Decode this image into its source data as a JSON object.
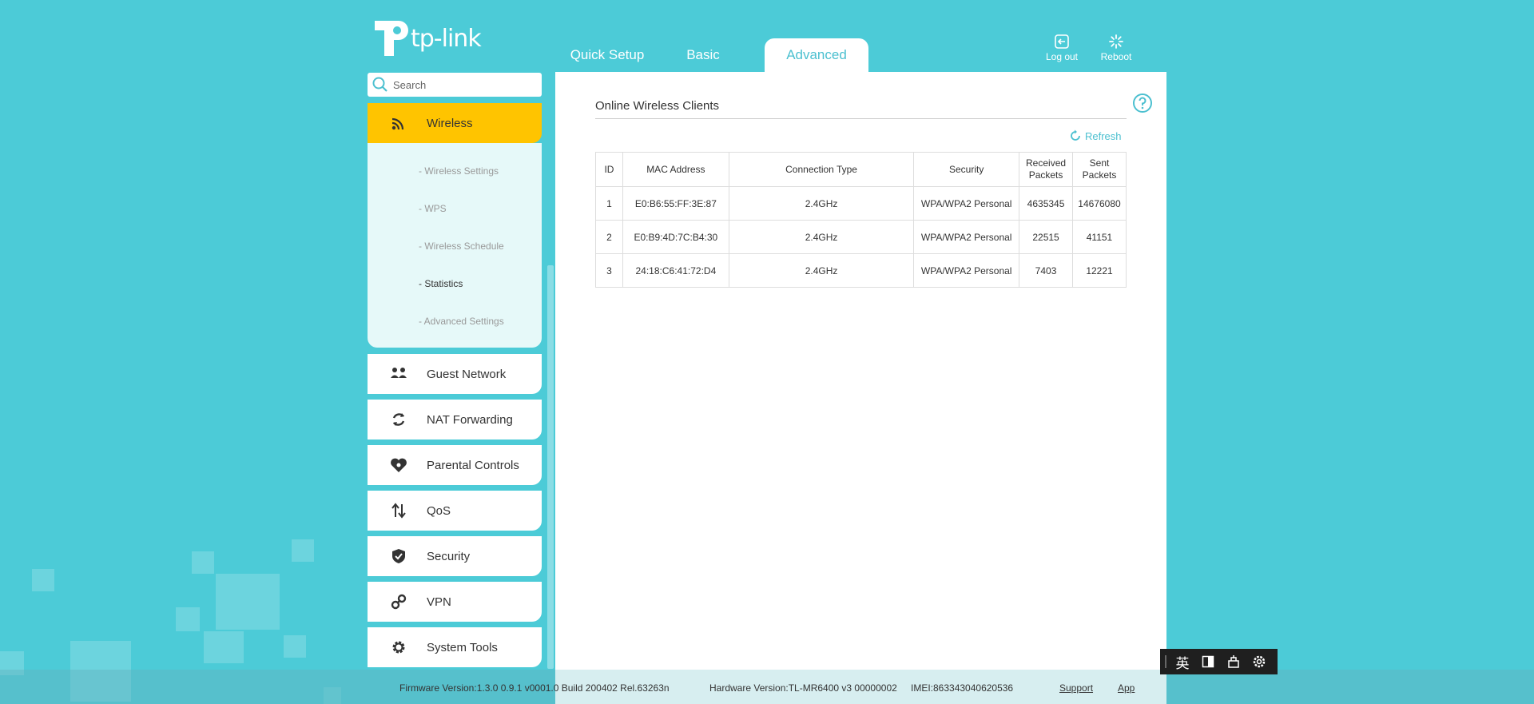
{
  "header": {
    "logo_text": "tp-link",
    "tabs": [
      {
        "label": "Quick Setup"
      },
      {
        "label": "Basic"
      },
      {
        "label": "Advanced"
      }
    ],
    "logout_label": "Log out",
    "reboot_label": "Reboot"
  },
  "sidebar": {
    "search_placeholder": "Search",
    "active_item": "Wireless",
    "submenu": [
      "- Wireless Settings",
      "- WPS",
      "- Wireless Schedule",
      "- Statistics",
      "- Advanced Settings"
    ],
    "items": [
      {
        "label": "Guest Network",
        "icon": "guest-network-icon"
      },
      {
        "label": "NAT Forwarding",
        "icon": "nat-forwarding-icon"
      },
      {
        "label": "Parental Controls",
        "icon": "parental-controls-icon"
      },
      {
        "label": "QoS",
        "icon": "qos-icon"
      },
      {
        "label": "Security",
        "icon": "security-icon"
      },
      {
        "label": "VPN",
        "icon": "vpn-icon"
      },
      {
        "label": "System Tools",
        "icon": "system-tools-icon"
      }
    ]
  },
  "main": {
    "section_title": "Online Wireless Clients",
    "refresh_label": "Refresh",
    "table": {
      "headers": [
        "ID",
        "MAC Address",
        "Connection Type",
        "Security",
        "Received Packets",
        "Sent Packets"
      ],
      "rows": [
        [
          "1",
          "E0:B6:55:FF:3E:87",
          "2.4GHz",
          "WPA/WPA2 Personal",
          "4635345",
          "14676080"
        ],
        [
          "2",
          "E0:B9:4D:7C:B4:30",
          "2.4GHz",
          "WPA/WPA2 Personal",
          "22515",
          "41151"
        ],
        [
          "3",
          "24:18:C6:41:72:D4",
          "2.4GHz",
          "WPA/WPA2 Personal",
          "7403",
          "12221"
        ]
      ]
    }
  },
  "footer": {
    "firmware": "Firmware Version:1.3.0 0.9.1 v0001.0 Build 200402 Rel.63263n",
    "hardware": "Hardware Version:TL-MR6400 v3 00000002",
    "imei": "IMEI:863343040620536",
    "support_label": "Support",
    "app_label": "App"
  },
  "ime": {
    "lang_label": "英"
  },
  "colors": {
    "background": "#4ccbd7",
    "accent": "#4cc0d0",
    "active_nav": "#ffc400"
  }
}
